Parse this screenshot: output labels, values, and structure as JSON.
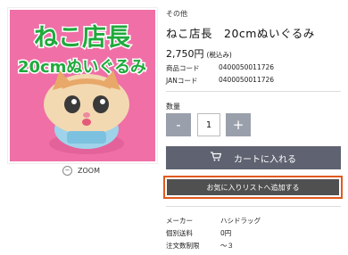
{
  "product_image": {
    "banner_line1": "ねこ店長",
    "banner_line2": "20cmぬいぐるみ",
    "bg_color": "#ef6fa6",
    "text_color": "#1faa3c"
  },
  "zoom_label": "ZOOM",
  "category": "その他",
  "title": "ねこ店長　20cmぬいぐるみ",
  "price": {
    "amount": "2,750円",
    "tax_note": "(税込み)"
  },
  "codes": [
    {
      "label": "商品コード",
      "value": "0400050011726"
    },
    {
      "label": "JANコード",
      "value": "0400050011726"
    }
  ],
  "quantity": {
    "label": "数量",
    "minus": "-",
    "value": "1",
    "plus": "+"
  },
  "cart_button": "カートに入れる",
  "favorite_button": "お気に入りリストへ追加する",
  "specs": [
    {
      "label": "メーカー",
      "value": "ハシドラッグ"
    },
    {
      "label": "個別送料",
      "value": "0円"
    },
    {
      "label": "注文数制限",
      "value": "～３"
    }
  ],
  "colors": {
    "cart_bg": "#5f6270",
    "fav_bg": "#505050",
    "highlight": "#e05a1e",
    "qty_btn": "#9aa0ab"
  }
}
